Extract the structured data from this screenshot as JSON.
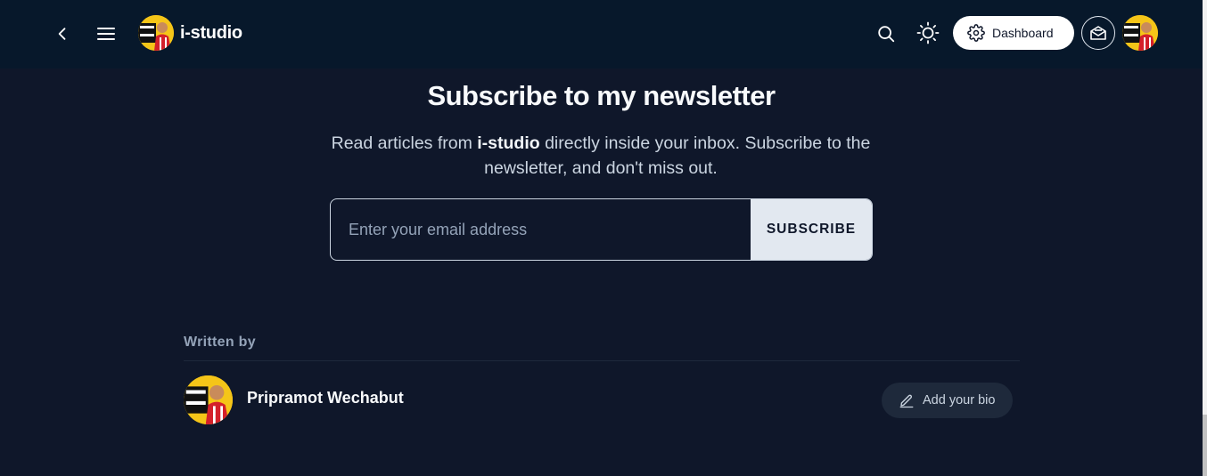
{
  "header": {
    "brand_name": "i-studio",
    "dashboard_label": "Dashboard",
    "icons": [
      "chevron-left-icon",
      "hamburger-menu-icon",
      "search-icon",
      "sun-icon",
      "gear-icon",
      "mail-icon"
    ]
  },
  "newsletter": {
    "title": "Subscribe to my newsletter",
    "desc_prefix": "Read articles from ",
    "desc_brand": "i-studio",
    "desc_suffix": " directly inside your inbox. Subscribe to the newsletter, and don't miss out.",
    "email_placeholder": "Enter your email address",
    "email_value": "",
    "subscribe_label": "SUBSCRIBE"
  },
  "author": {
    "section_label": "Written by",
    "name": "Pripramot Wechabut",
    "bio_button_label": "Add your bio"
  },
  "colors": {
    "background": "#0f172a",
    "header_background": "#07182b",
    "subscribe_button": "#e2e8f0",
    "bio_button": "#1e293b"
  }
}
